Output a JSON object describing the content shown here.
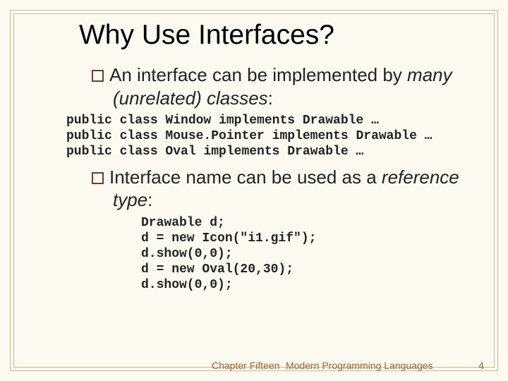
{
  "title": "Why Use Interfaces?",
  "bullets": [
    {
      "lead": "An",
      "rest": " interface can be implemented by ",
      "italic": "many (unrelated) classes",
      "tail": ":"
    },
    {
      "lead": "Interface",
      "rest": " name can be used as a ",
      "italic": "reference type",
      "tail": ":"
    }
  ],
  "code1": "public class Window implements Drawable …\npublic class Mouse.Pointer implements Drawable …\npublic class Oval implements Drawable …",
  "code2": "Drawable d;\nd = new Icon(\"i1.gif\");\nd.show(0,0);\nd = new Oval(20,30);\nd.show(0,0);",
  "footer": {
    "chapter": "Chapter Fifteen",
    "book": "Modern Programming Languages",
    "page": "4"
  }
}
